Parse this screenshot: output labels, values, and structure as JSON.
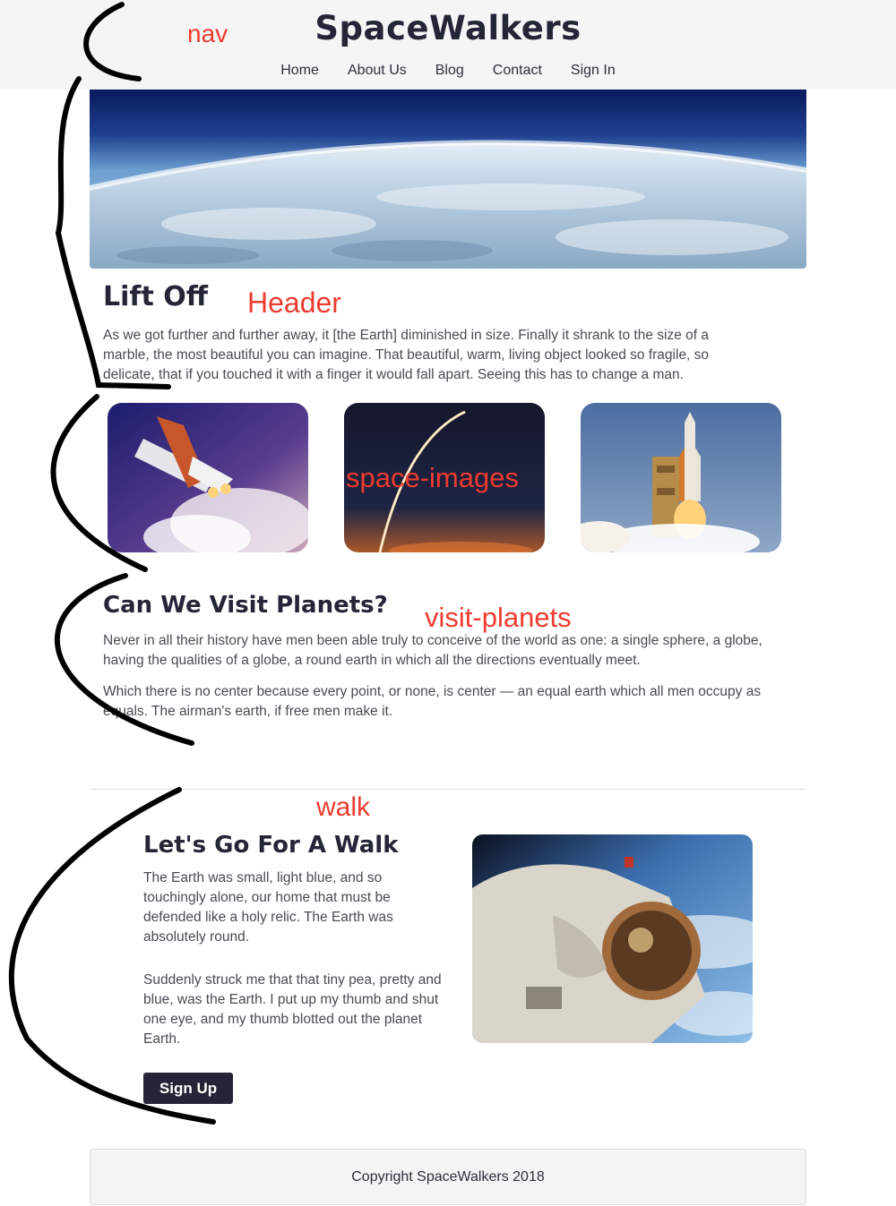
{
  "nav": {
    "brand": "SpaceWalkers",
    "links": [
      "Home",
      "About Us",
      "Blog",
      "Contact",
      "Sign In"
    ]
  },
  "header": {
    "title": "Lift Off",
    "paragraph": "As we got further and further away, it [the Earth] diminished in size. Finally it shrank to the size of a marble, the most beautiful you can imagine. That beautiful, warm, living object looked so fragile, so delicate, that if you touched it with a finger it would fall apart. Seeing this has to change a man."
  },
  "visit_planets": {
    "title": "Can We Visit Planets?",
    "paragraphs": [
      "Never in all their history have men been able truly to conceive of the world as one: a single sphere, a globe, having the qualities of a globe, a round earth in which all the directions eventually meet.",
      "Which there is no center because every point, or none, is center — an equal earth which all men occupy as equals. The airman's earth, if free men make it."
    ]
  },
  "walk": {
    "title": "Let's Go For A Walk",
    "paragraphs": [
      "The Earth was small, light blue, and so touchingly alone, our home that must be defended like a holy relic. The Earth was absolutely round.",
      "Suddenly struck me that that tiny pea, pretty and blue, was the Earth. I put up my thumb and shut one eye, and my thumb blotted out the planet Earth."
    ],
    "button": "Sign Up"
  },
  "footer": {
    "text": "Copyright SpaceWalkers 2018"
  },
  "annotations": {
    "nav": "nav",
    "header": "Header",
    "space_images": "space-images",
    "visit_planets": "visit-planets",
    "walk": "walk"
  },
  "colors": {
    "dark": "#242638",
    "annotation": "#ee3b2f",
    "nav_bg": "#f5f5f5"
  },
  "icons": [
    "earth-horizon-image",
    "shuttle-launch-image",
    "rocket-trail-image",
    "launch-pad-image",
    "astronaut-image"
  ]
}
